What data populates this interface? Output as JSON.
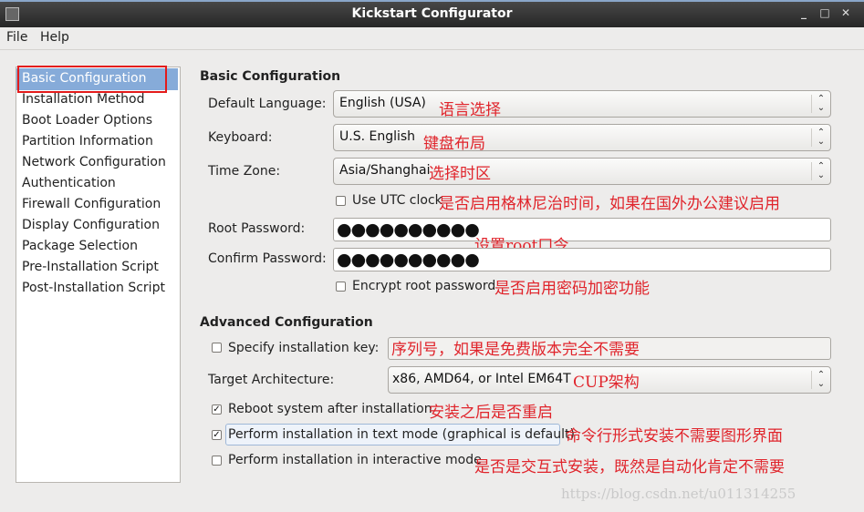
{
  "window": {
    "title": "Kickstart Configurator"
  },
  "menu": {
    "file": "File",
    "help": "Help"
  },
  "sidebar": {
    "items": [
      {
        "label": "Basic Configuration"
      },
      {
        "label": "Installation Method"
      },
      {
        "label": "Boot Loader Options"
      },
      {
        "label": "Partition Information"
      },
      {
        "label": "Network Configuration"
      },
      {
        "label": "Authentication"
      },
      {
        "label": "Firewall Configuration"
      },
      {
        "label": "Display Configuration"
      },
      {
        "label": "Package Selection"
      },
      {
        "label": "Pre-Installation Script"
      },
      {
        "label": "Post-Installation Script"
      }
    ],
    "selected": "Basic Configuration"
  },
  "basic": {
    "heading": "Basic Configuration",
    "default_language_label": "Default Language:",
    "default_language_value": "English (USA)",
    "keyboard_label": "Keyboard:",
    "keyboard_value": "U.S. English",
    "timezone_label": "Time Zone:",
    "timezone_value": "Asia/Shanghai",
    "utc_label": "Use UTC clock",
    "utc_checked": false,
    "root_password_label": "Root Password:",
    "root_password_value": "●●●●●●●●●●",
    "confirm_password_label": "Confirm Password:",
    "confirm_password_value": "●●●●●●●●●●",
    "encrypt_label": "Encrypt root password",
    "encrypt_checked": false
  },
  "advanced": {
    "heading": "Advanced Configuration",
    "install_key_label": "Specify installation key:",
    "install_key_checked": false,
    "install_key_value": "",
    "target_arch_label": "Target Architecture:",
    "target_arch_value": "x86, AMD64, or Intel EM64T",
    "reboot_label": "Reboot system after installation",
    "reboot_checked": true,
    "text_mode_label": "Perform installation in text mode (graphical is default)",
    "text_mode_checked": true,
    "interactive_label": "Perform installation in interactive mode",
    "interactive_checked": false
  },
  "annotations": {
    "language": "语言选择",
    "keyboard": "键盘布局",
    "timezone": "选择时区",
    "utc": "是否启用格林尼治时间，如果在国外办公建议启用",
    "root_password": "设置root口令",
    "encrypt": "是否启用密码加密功能",
    "install_key": "序列号，如果是免费版本完全不需要",
    "arch": "CUP架构",
    "reboot": "安装之后是否重启",
    "text_mode": "命令行形式安装不需要图形界面",
    "interactive": "是否是交互式安装，既然是自动化肯定不需要"
  },
  "watermark": "https://blog.csdn.net/u011314255",
  "icons": {
    "app": "app-icon",
    "minimize": "minimize-icon",
    "maximize": "maximize-icon",
    "close": "close-icon",
    "combo_arrow": "updown-arrow-icon",
    "check": "checkmark-icon"
  },
  "colors": {
    "selection": "#86abd9",
    "annotation": "#e0242b",
    "highlight_box": "#e31b1b"
  }
}
